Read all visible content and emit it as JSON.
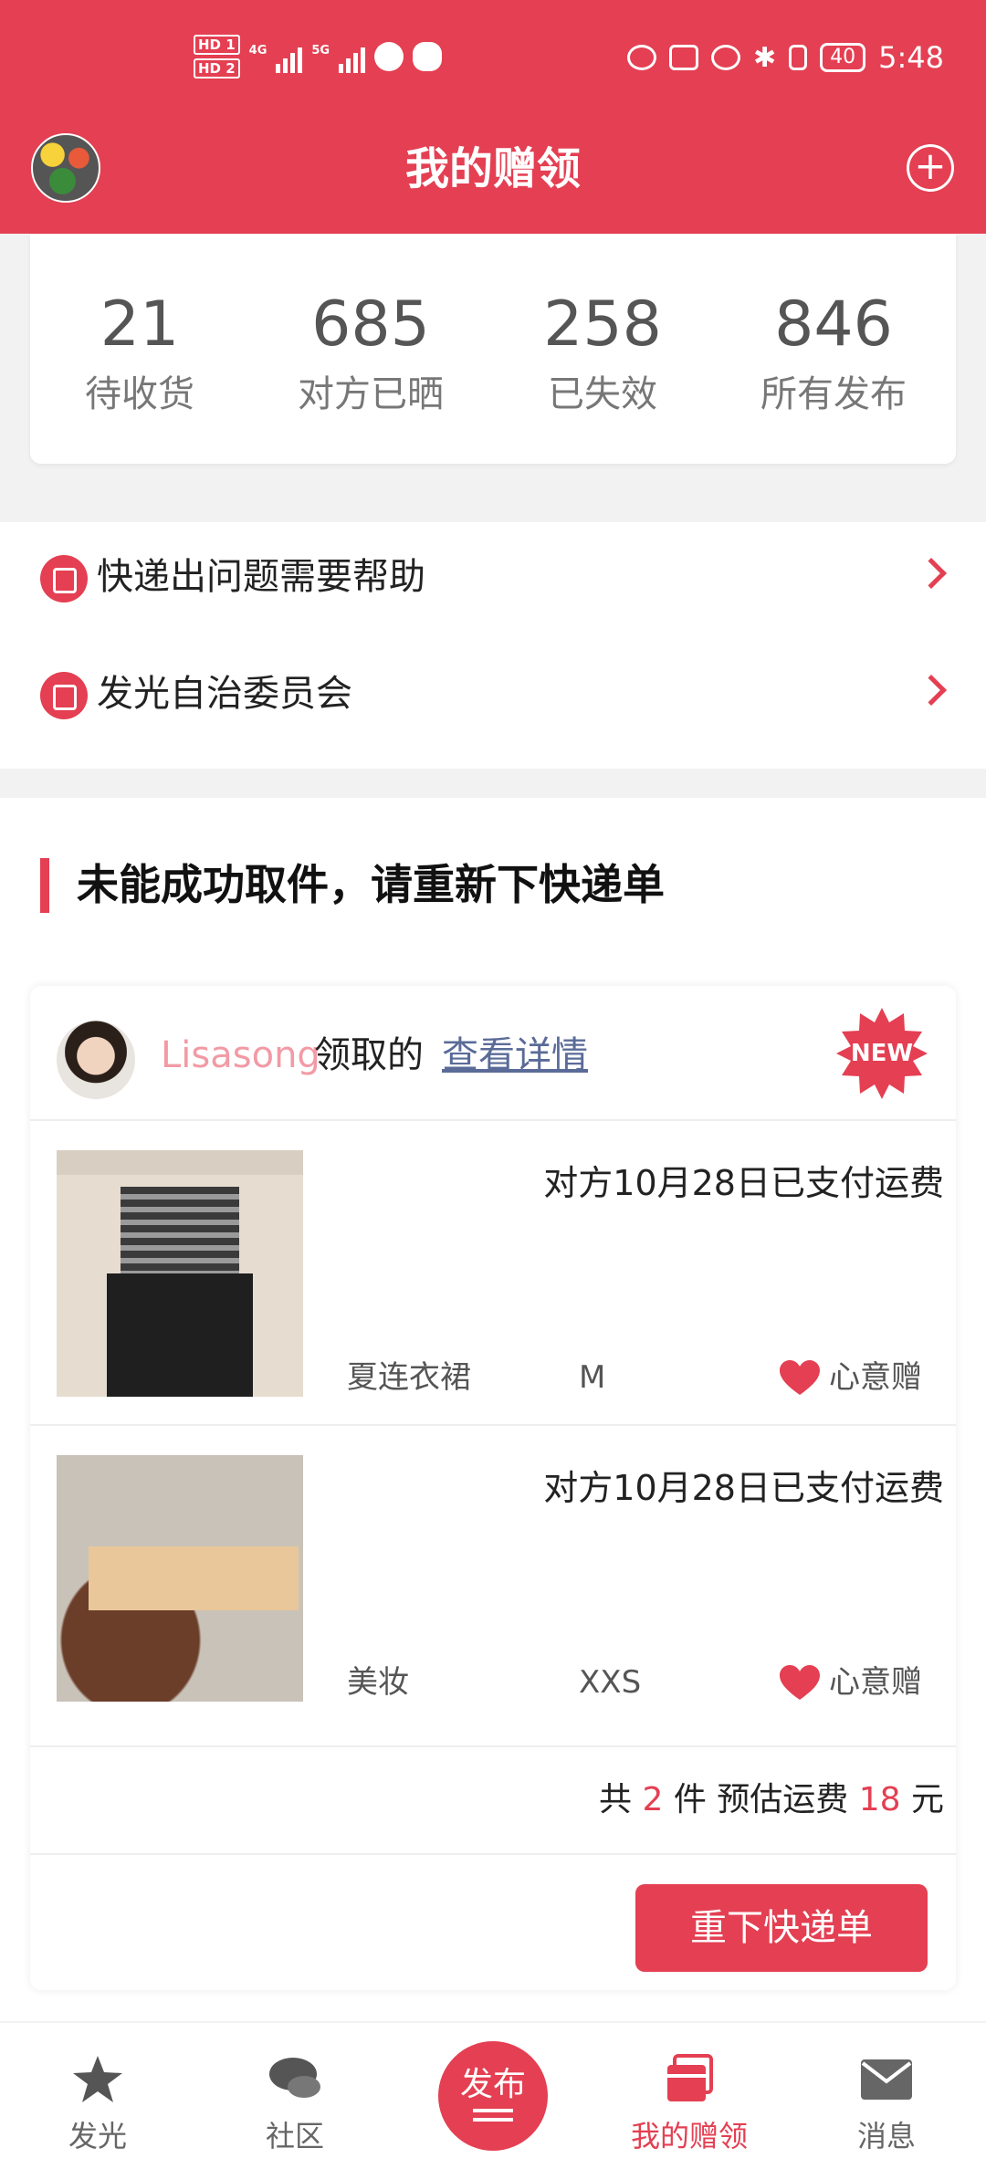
{
  "status_bar": {
    "hd1": "HD 1",
    "hd2": "HD 2",
    "net1": "4G",
    "net2": "5G",
    "battery": "40",
    "time": "5:48"
  },
  "header": {
    "title": "我的赠领"
  },
  "stats": [
    {
      "value": "21",
      "label": "待收货"
    },
    {
      "value": "685",
      "label": "对方已晒"
    },
    {
      "value": "258",
      "label": "已失效"
    },
    {
      "value": "846",
      "label": "所有发布"
    }
  ],
  "links": [
    {
      "label": "快递出问题需要帮助"
    },
    {
      "label": "发光自治委员会"
    }
  ],
  "section": {
    "title": "未能成功取件，请重新下快递单"
  },
  "order": {
    "user_name": "Lisasong",
    "verb": "领取的",
    "detail_link": "查看详情",
    "badge": "NEW",
    "items": [
      {
        "status": "对方10月28日已支付运费",
        "category": "夏连衣裙",
        "size": "M",
        "tag": "心意赠"
      },
      {
        "status": "对方10月28日已支付运费",
        "category": "美妆",
        "size": "XXS",
        "tag": "心意赠"
      }
    ],
    "summary": {
      "prefix": "共",
      "count": "2",
      "mid": "件 预估运费",
      "fee": "18",
      "suffix": "元"
    },
    "reorder_button": "重下快递单"
  },
  "tabs": [
    {
      "label": "发光",
      "icon": "star-icon"
    },
    {
      "label": "社区",
      "icon": "chat-bubble-icon"
    },
    {
      "label": "发布",
      "icon": "publish-icon"
    },
    {
      "label": "我的赠领",
      "icon": "cards-icon",
      "active": true
    },
    {
      "label": "消息",
      "icon": "envelope-icon"
    }
  ],
  "colors": {
    "brand": "#e43f52",
    "link": "#5a6b98",
    "username": "#f29aa5"
  }
}
